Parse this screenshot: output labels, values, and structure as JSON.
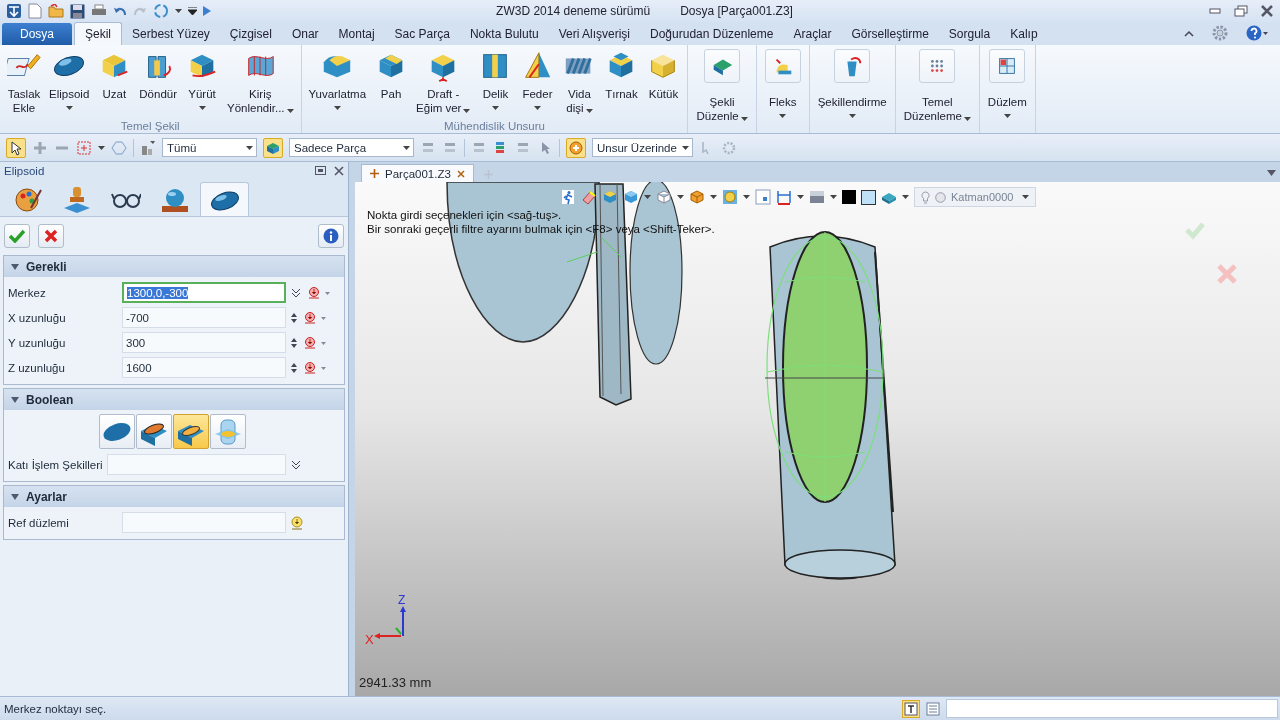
{
  "window": {
    "app_title": "ZW3D 2014 deneme sürümü",
    "document_title": "Dosya [Parça001.Z3]"
  },
  "menu_tabs": [
    {
      "label": "Dosya",
      "kind": "file",
      "selected": false
    },
    {
      "label": "Şekil",
      "kind": "tab",
      "selected": true
    },
    {
      "label": "Serbest Yüzey",
      "kind": "tab",
      "selected": false
    },
    {
      "label": "Çizgisel",
      "kind": "tab",
      "selected": false
    },
    {
      "label": "Onar",
      "kind": "tab",
      "selected": false
    },
    {
      "label": "Montaj",
      "kind": "tab",
      "selected": false
    },
    {
      "label": "Sac Parça",
      "kind": "tab",
      "selected": false
    },
    {
      "label": "Nokta Bulutu",
      "kind": "tab",
      "selected": false
    },
    {
      "label": "Veri Alışverişi",
      "kind": "tab",
      "selected": false
    },
    {
      "label": "Doğurudan Düzenleme",
      "kind": "tab",
      "selected": false
    },
    {
      "label": "Araçlar",
      "kind": "tab",
      "selected": false
    },
    {
      "label": "Görselleştirme",
      "kind": "tab",
      "selected": false
    },
    {
      "label": "Sorgula",
      "kind": "tab",
      "selected": false
    },
    {
      "label": "Kalıp",
      "kind": "tab",
      "selected": false
    }
  ],
  "ribbon_groups": [
    {
      "kind": "large",
      "title": "Temel Şekil",
      "buttons": [
        {
          "label": "Taslak\nEkle",
          "dropdown": false
        },
        {
          "label": "Elipsoid",
          "dropdown": true
        },
        {
          "label": "Uzat",
          "dropdown": false
        },
        {
          "label": "Döndür",
          "dropdown": false
        },
        {
          "label": "Yürüt",
          "dropdown": true
        },
        {
          "label": "Kiriş\nYönlendir...",
          "dropdown": true
        }
      ]
    },
    {
      "kind": "large",
      "title": "Mühendislik Unsuru",
      "buttons": [
        {
          "label": "Yuvarlatma",
          "dropdown": true
        },
        {
          "label": "Pah",
          "dropdown": false
        },
        {
          "label": "Draft -\nEğim ver",
          "dropdown": true
        },
        {
          "label": "Delik",
          "dropdown": true
        },
        {
          "label": "Feder",
          "dropdown": true
        },
        {
          "label": "Vida\ndişi",
          "dropdown": true
        },
        {
          "label": "Tırnak",
          "dropdown": false
        },
        {
          "label": "Kütük",
          "dropdown": false
        }
      ]
    },
    {
      "kind": "compact",
      "buttons": [
        {
          "label": "Şekli\nDüzenle",
          "dropdown": true
        }
      ]
    },
    {
      "kind": "compact",
      "buttons": [
        {
          "label": "Fleks",
          "dropdown": true
        }
      ]
    },
    {
      "kind": "compact",
      "buttons": [
        {
          "label": "Şekillendirme",
          "dropdown": true
        }
      ]
    },
    {
      "kind": "compact",
      "buttons": [
        {
          "label": "Temel\nDüzenleme",
          "dropdown": true
        }
      ]
    },
    {
      "kind": "compact",
      "buttons": [
        {
          "label": "Düzlem",
          "dropdown": true
        }
      ]
    }
  ],
  "filter_bar": {
    "dropdowns": [
      {
        "value": "Tümü"
      },
      {
        "value": "Sadece Parça"
      },
      {
        "value": "Unsur Üzerinde"
      }
    ]
  },
  "panel": {
    "title": "Elipsoid",
    "tabs": [
      {
        "selected": false
      },
      {
        "selected": false
      },
      {
        "selected": false
      },
      {
        "selected": false
      },
      {
        "selected": true
      }
    ],
    "sections": [
      {
        "title": "Gerekli",
        "expanded": true,
        "kind": "fields",
        "fields": [
          {
            "label": "Merkez",
            "value": "1300,0,-300",
            "kind": "point",
            "focused": true
          },
          {
            "label": "X uzunluğu",
            "value": "-700",
            "kind": "spin",
            "focused": false
          },
          {
            "label": "Y uzunluğu",
            "value": "300",
            "kind": "spin",
            "focused": false
          },
          {
            "label": "Z uzunluğu",
            "value": "1600",
            "kind": "spin",
            "focused": false
          }
        ]
      },
      {
        "title": "Boolean",
        "expanded": true,
        "kind": "boolean",
        "options": [
          {
            "selected": false
          },
          {
            "selected": false
          },
          {
            "selected": true
          },
          {
            "selected": false
          }
        ],
        "fields": [
          {
            "label": "Katı İşlem Şekilleri",
            "kind": "list",
            "focused": false
          }
        ]
      },
      {
        "title": "Ayarlar",
        "expanded": true,
        "kind": "fields",
        "fields": [
          {
            "label": "Ref düzlemi",
            "kind": "pick",
            "focused": false
          }
        ]
      }
    ]
  },
  "viewport": {
    "doc_tabs": [
      {
        "label": "Parça001.Z3",
        "selected": true
      }
    ],
    "layer": "Katman0000",
    "hints": [
      "Nokta girdi seçenekleri için <sağ-tuş>.",
      "Bir sonraki geçerli filtre ayarını bulmak için <F8> veya <Shift-Teker>."
    ],
    "axis_labels": {
      "x": "X",
      "z": "Z"
    },
    "scale": "2941.33 mm"
  },
  "status_bar": {
    "prompt": "Merkez noktayı seç."
  }
}
